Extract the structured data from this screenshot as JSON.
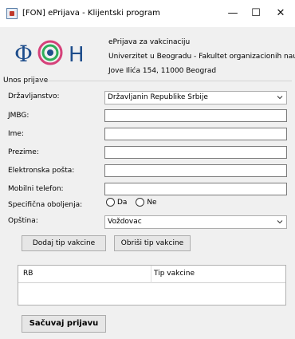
{
  "window": {
    "title": "[FON] ePrijava - Klijentski program",
    "minimize_glyph": "—",
    "maximize_glyph": "☐",
    "close_glyph": "✕"
  },
  "header": {
    "logo_text": "ΦH",
    "line1": "ePrijava za vakcinaciju",
    "line2": "Univerzitet u Beogradu - Fakultet organizacionih nauka",
    "line3": "Jove Ilića 154, 11000 Beograd"
  },
  "form": {
    "section_title": "Unos prijave",
    "citizenship_label": "Državljanstvo:",
    "citizenship_value": "Državljanin Republike Srbije",
    "jmbg_label": "JMBG:",
    "jmbg_value": "",
    "first_name_label": "Ime:",
    "first_name_value": "",
    "last_name_label": "Prezime:",
    "last_name_value": "",
    "email_label": "Elektronska pošta:",
    "email_value": "",
    "phone_label": "Mobilni telefon:",
    "phone_value": "",
    "conditions_label": "Specifična oboljenja:",
    "conditions_yes": "Da",
    "conditions_no": "Ne",
    "municipality_label": "Opština:",
    "municipality_value": "Voždovac"
  },
  "buttons": {
    "add_vaccine_type": "Dodaj tip vakcine",
    "remove_vaccine_type": "Obriši tip vakcine",
    "save": "Sačuvaj prijavu"
  },
  "table": {
    "columns": [
      "RB",
      "Tip vakcine"
    ],
    "rows": []
  },
  "colors": {
    "logo_blue": "#1f4e8c",
    "logo_green": "#2eae5a",
    "logo_pink": "#d6417a"
  }
}
